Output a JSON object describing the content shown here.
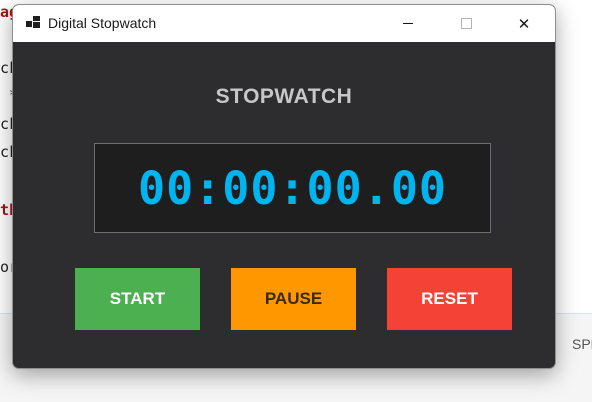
{
  "background": {
    "lines": [
      {
        "text": "ag",
        "red": true
      },
      {
        "text": "ck",
        "red": false
      },
      {
        "text": " *",
        "red": false
      },
      {
        "text": "ck",
        "red": false
      },
      {
        "text": "ck",
        "red": false
      },
      {
        "text": "th",
        "red": true
      },
      {
        "text": "or",
        "red": false
      }
    ],
    "right_fragment": "SPE"
  },
  "window": {
    "title": "Digital Stopwatch",
    "minimize_glyph": "—",
    "close_glyph": "✕"
  },
  "main": {
    "heading": "STOPWATCH",
    "time": "00:00:00.00",
    "time_color": "#00b4f0"
  },
  "buttons": {
    "start": "START",
    "pause": "PAUSE",
    "reset": "RESET"
  },
  "colors": {
    "start": "#4caf50",
    "pause": "#ff9800",
    "reset": "#f44336",
    "window_bg": "#2d2d30"
  }
}
